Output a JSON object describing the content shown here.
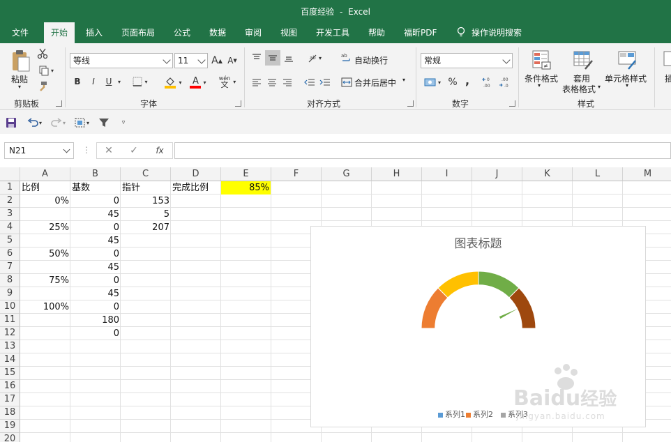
{
  "titlebar": {
    "doc": "百度经验",
    "sep": "-",
    "app": "Excel"
  },
  "menu": {
    "tabs": [
      "文件",
      "开始",
      "插入",
      "页面布局",
      "公式",
      "数据",
      "审阅",
      "视图",
      "开发工具",
      "帮助",
      "福昕PDF"
    ],
    "active": "开始",
    "tell_me": "操作说明搜索"
  },
  "ribbon": {
    "clipboard": {
      "paste": "粘贴",
      "label": "剪贴板"
    },
    "font": {
      "name": "等线",
      "size": "11",
      "bold": "B",
      "italic": "I",
      "underline": "U",
      "grow": "A",
      "shrink": "A",
      "color_letter": "A",
      "wen": "wén",
      "wen2": "文",
      "label": "字体",
      "highlight_color": "#FFC000",
      "font_color": "#FF0000"
    },
    "alignment": {
      "wrap": "自动换行",
      "merge": "合并后居中",
      "label": "对齐方式"
    },
    "number": {
      "format": "常规",
      "percent": "%",
      "comma": ",",
      "label": "数字"
    },
    "styles": {
      "conditional": "条件格式",
      "table_format_1": "套用",
      "table_format_2": "表格格式",
      "cell_styles": "单元格样式",
      "label": "样式"
    },
    "cells": {
      "insert": "插"
    }
  },
  "formula_bar": {
    "name_box": "N21",
    "fx": "fx",
    "value": ""
  },
  "columns": [
    "A",
    "B",
    "C",
    "D",
    "E",
    "F",
    "G",
    "H",
    "I",
    "J",
    "K",
    "L",
    "M"
  ],
  "rows": [
    "1",
    "2",
    "3",
    "4",
    "5",
    "6",
    "7",
    "8",
    "9",
    "10",
    "11",
    "12",
    "13",
    "14",
    "15",
    "16",
    "17",
    "18",
    "19",
    "20"
  ],
  "cells": {
    "A1": "比例",
    "B1": "基数",
    "C1": "指针",
    "D1": "完成比例",
    "E1": "85%",
    "A2": "0%",
    "B2": "0",
    "C2": "153",
    "B3": "45",
    "C3": "5",
    "A4": "25%",
    "B4": "0",
    "C4": "207",
    "B5": "45",
    "A6": "50%",
    "B6": "0",
    "B7": "45",
    "A8": "75%",
    "B8": "0",
    "B9": "45",
    "A10": "100%",
    "B10": "0",
    "B11": "180",
    "B12": "0"
  },
  "highlight_color": "#FFFF00",
  "accent": "#217346",
  "chart_data": {
    "type": "pie",
    "title": "图表标题",
    "series": [
      {
        "name": "系列1",
        "values": [
          0,
          45,
          0,
          45,
          0,
          45,
          0,
          45,
          0,
          180,
          0
        ],
        "colors": [
          "#ED7D31",
          "#ED7D31",
          "#FFC000",
          "#FFC000",
          "#70AD47",
          "#70AD47",
          "#9E480E",
          "#9E480E",
          "#9E480E",
          "#FFFFFF",
          "#FFFFFF"
        ]
      },
      {
        "name": "系列2",
        "values": [
          153,
          5,
          207
        ],
        "colors": [
          "#FFFFFF",
          "#70AD47",
          "#FFFFFF"
        ]
      },
      {
        "name": "系列3",
        "values": []
      }
    ],
    "legend": [
      "系列1",
      "系列2",
      "系列3"
    ],
    "legend_colors": [
      "#5B9BD5",
      "#ED7D31",
      "#A5A5A5"
    ],
    "legend_position": "bottom",
    "start_angle": 270,
    "hole_ratio": 0.76
  },
  "watermark": {
    "brand": "Baidu",
    "brand2": "经验",
    "url": "jingyan.baidu.com"
  }
}
